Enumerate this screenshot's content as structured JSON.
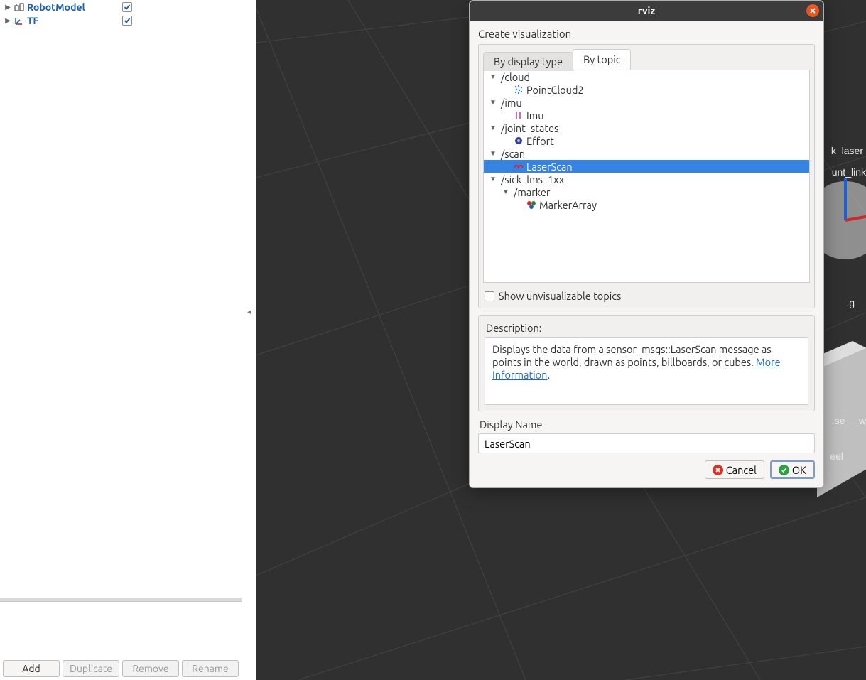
{
  "sidebar": {
    "items": [
      {
        "label": "RobotModel",
        "checked": true
      },
      {
        "label": "TF",
        "checked": true
      }
    ],
    "buttons": {
      "add": "Add",
      "duplicate": "Duplicate",
      "remove": "Remove",
      "rename": "Rename"
    }
  },
  "viewport": {
    "link_labels": {
      "laser": "k_laser",
      "mount": "unt_link",
      "g": ".g",
      "se_w": ".se_ _w",
      "wheel": "eel"
    }
  },
  "dialog": {
    "window_title": "rviz",
    "heading": "Create visualization",
    "tabs": {
      "by_type": "By display type",
      "by_topic": "By topic"
    },
    "tree": {
      "cloud": {
        "topic": "/cloud",
        "child_display": "PointCloud2"
      },
      "imu": {
        "topic": "/imu",
        "child_display": "Imu"
      },
      "joint_states": {
        "topic": "/joint_states",
        "child_display": "Effort"
      },
      "scan": {
        "topic": "/scan",
        "child_display": "LaserScan"
      },
      "sick": {
        "topic": "/sick_lms_1xx",
        "marker_topic": "/marker",
        "child_display": "MarkerArray"
      }
    },
    "show_unviz_label": "Show unvisualizable topics",
    "show_unviz_checked": false,
    "description_label": "Description:",
    "description_text": "Displays the data from a sensor_msgs::LaserScan message as points in the world, drawn as points, billboards, or cubes. ",
    "description_link": "More Information",
    "description_trail": ".",
    "display_name_label": "Display Name",
    "display_name_value": "LaserScan",
    "buttons": {
      "cancel": "Cancel",
      "ok_prefix": "O",
      "ok_rest": "K"
    }
  }
}
